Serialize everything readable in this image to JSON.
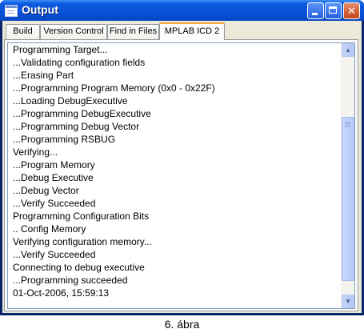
{
  "window": {
    "title": "Output"
  },
  "tabs": [
    {
      "label": "Build"
    },
    {
      "label": "Version Control"
    },
    {
      "label": "Find in Files"
    },
    {
      "label": "MPLAB ICD 2",
      "active": true
    }
  ],
  "output_lines": [
    "Programming Target...",
    "...Validating configuration fields",
    "...Erasing Part",
    "...Programming Program Memory (0x0 - 0x22F)",
    "...Loading DebugExecutive",
    "...Programming DebugExecutive",
    "...Programming Debug Vector",
    "...Programming RSBUG",
    "Verifying...",
    "...Program Memory",
    "...Debug Executive",
    "...Debug Vector",
    "...Verify Succeeded",
    "Programming Configuration Bits",
    ".. Config Memory",
    "Verifying configuration memory...",
    "...Verify Succeeded",
    "Connecting to debug executive",
    "...Programming succeeded",
    "01-Oct-2006, 15:59:13"
  ],
  "caption": "6. ábra",
  "colors": {
    "titlebar": "#0851d6",
    "active_tab_accent": "#f8a83c",
    "close_button": "#c4441a"
  },
  "icons": {
    "minimize": "minimize-icon",
    "maximize": "maximize-icon",
    "close": "close-icon",
    "scroll_up": "arrow-up-icon",
    "scroll_down": "arrow-down-icon"
  }
}
